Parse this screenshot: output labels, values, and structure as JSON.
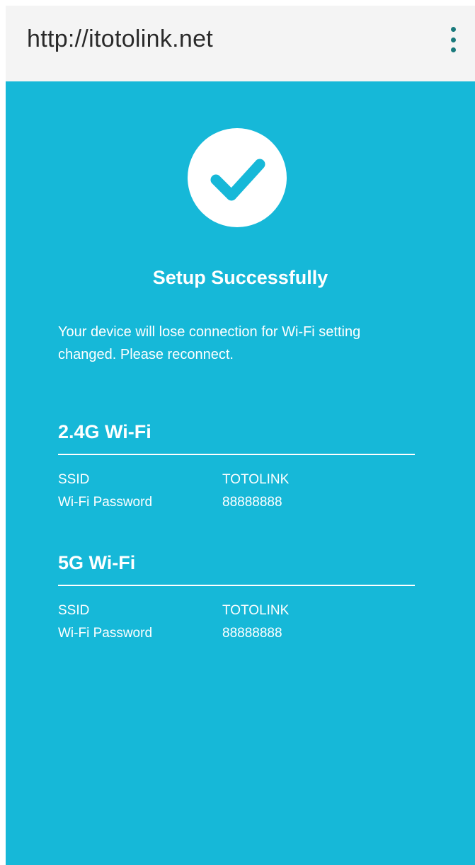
{
  "browser": {
    "url": "http://itotolink.net",
    "menu_icon": "more-vert-icon"
  },
  "colors": {
    "background": "#16b8d8",
    "check": "#16b8d8",
    "text": "#ffffff",
    "address_bar": "#f4f4f4",
    "menu_dots": "#1a7a7c"
  },
  "status": {
    "icon": "checkmark-circle-icon",
    "title": "Setup Successfully",
    "message": "Your device will lose connection for Wi-Fi setting changed. Please reconnect."
  },
  "networks": [
    {
      "title": "2.4G Wi-Fi",
      "ssid_label": "SSID",
      "ssid": "TOTOLINK",
      "password_label": "Wi-Fi Password",
      "password": "88888888"
    },
    {
      "title": "5G Wi-Fi",
      "ssid_label": "SSID",
      "ssid": "TOTOLINK",
      "password_label": "Wi-Fi Password",
      "password": "88888888"
    }
  ]
}
